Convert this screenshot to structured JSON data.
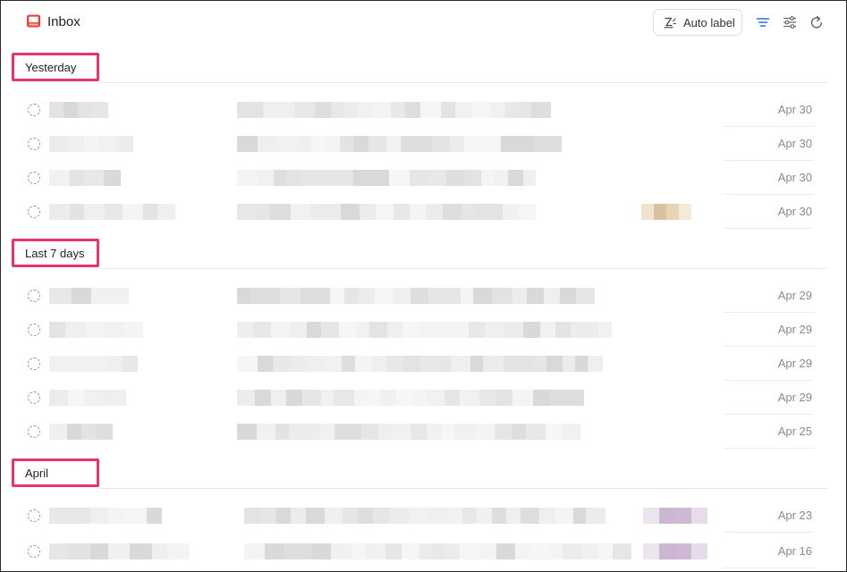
{
  "header": {
    "title": "Inbox",
    "auto_label": "Auto label",
    "accent": "#2f6fe0"
  },
  "sections": [
    {
      "label": "Yesterday",
      "rows": [
        {
          "date": "Apr 30"
        },
        {
          "date": "Apr 30"
        },
        {
          "date": "Apr 30"
        },
        {
          "date": "Apr 30"
        }
      ]
    },
    {
      "label": "Last 7 days",
      "rows": [
        {
          "date": "Apr 29"
        },
        {
          "date": "Apr 29"
        },
        {
          "date": "Apr 29"
        },
        {
          "date": "Apr 29"
        },
        {
          "date": "Apr 25"
        }
      ]
    },
    {
      "label": "April",
      "rows": [
        {
          "date": "Apr 23"
        },
        {
          "date": "Apr 16"
        }
      ]
    }
  ],
  "icons": [
    "inbox-icon",
    "auto-label-icon",
    "filter-icon",
    "sliders-icon",
    "refresh-icon",
    "unread-circle-icon"
  ]
}
